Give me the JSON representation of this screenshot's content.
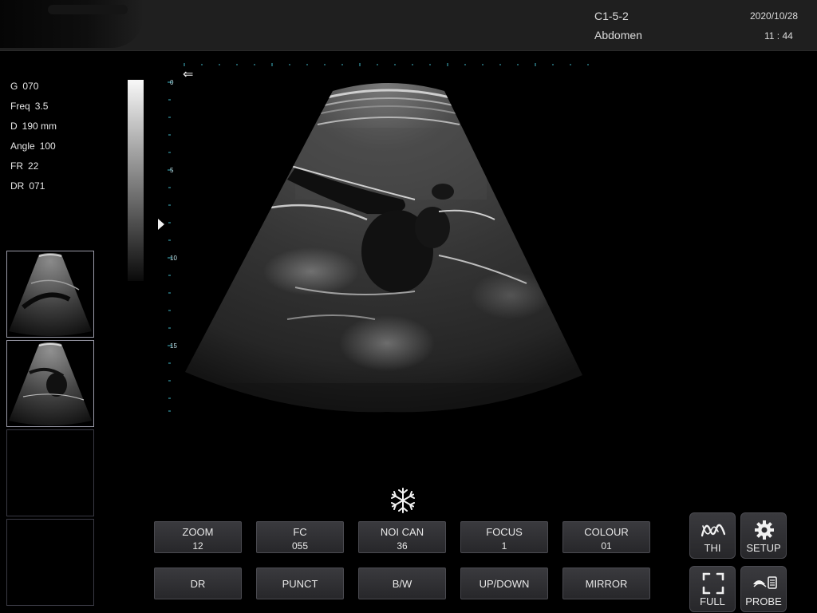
{
  "header": {
    "probe": "C1-5-2",
    "exam": "Abdomen",
    "date": "2020/10/28",
    "time": "11 : 44"
  },
  "params": [
    {
      "label": "G",
      "value": "070"
    },
    {
      "label": "Freq",
      "value": "3.5"
    },
    {
      "label": "D",
      "value": "190 mm"
    },
    {
      "label": "Angle",
      "value": "100"
    },
    {
      "label": "FR",
      "value": "22"
    },
    {
      "label": "DR",
      "value": "071"
    }
  ],
  "depth_scale": [
    "0",
    "5",
    "10",
    "15"
  ],
  "buttons_top": [
    {
      "label": "ZOOM",
      "value": "12"
    },
    {
      "label": "FC",
      "value": "055"
    },
    {
      "label": "NOI CAN",
      "value": "36"
    },
    {
      "label": "FOCUS",
      "value": "1"
    },
    {
      "label": "COLOUR",
      "value": "01"
    }
  ],
  "buttons_bottom": [
    {
      "label": "DR"
    },
    {
      "label": "PUNCT"
    },
    {
      "label": "B/W"
    },
    {
      "label": "UP/DOWN"
    },
    {
      "label": "MIRROR"
    }
  ],
  "side_buttons": {
    "thi": "THI",
    "setup": "SETUP",
    "full": "FULL",
    "probe": "PROBE"
  },
  "icons": {
    "orientation": "left-arrow-icon",
    "freeze": "snowflake-icon",
    "thi": "wave-icon",
    "setup": "gear-icon",
    "full": "fullscreen-icon",
    "probe": "probe-icon"
  },
  "colors": {
    "background": "#000000",
    "header": "#1f1f1f",
    "button": "#333336",
    "ruler_ticks": "#3fb9c9"
  }
}
